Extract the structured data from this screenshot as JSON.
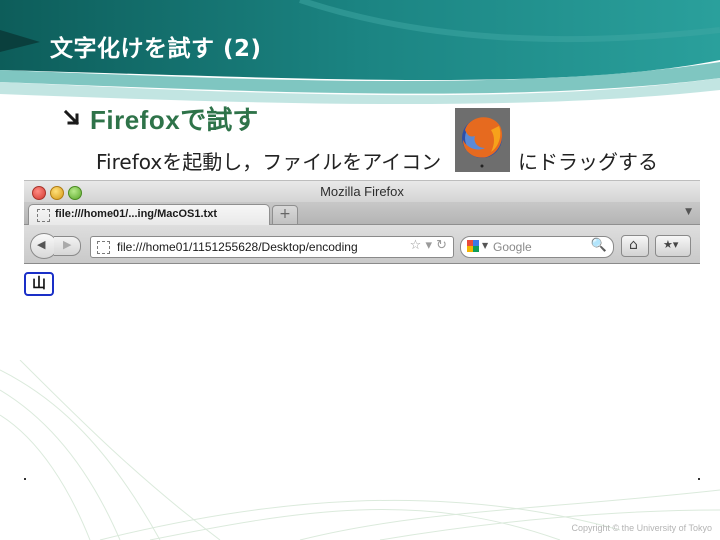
{
  "slide": {
    "title": "文字化けを試す (2)",
    "bullet_latin": "Firefox",
    "bullet_jp": "で試す",
    "subtext_part1": "Firefoxを起動し，ファイルをアイコン",
    "subtext_part2": "にドラッグする",
    "copyright": "Copyright © the University of Tokyo"
  },
  "browser": {
    "window_title": "Mozilla Firefox",
    "tab_label": "file:///home01/...ing/MacOS1.txt",
    "new_tab_glyph": "+",
    "tab_list_glyph": "▼",
    "back_glyph": "◀",
    "forward_glyph": "▶",
    "url": "file:///home01/1151255628/Desktop/encoding",
    "url_icons": "☆ ▾ ↻",
    "search_placeholder": "Google",
    "search_glyph": "🔍",
    "search_dropdown_glyph": "▼",
    "home_glyph": "⌂",
    "bookmarks_glyph": "★▾"
  },
  "page_content": {
    "displayed_char": "山"
  },
  "colors": {
    "header_teal": "#1a7d7d",
    "bullet_green": "#2e7349",
    "char_box_border": "#1a2fc7"
  }
}
